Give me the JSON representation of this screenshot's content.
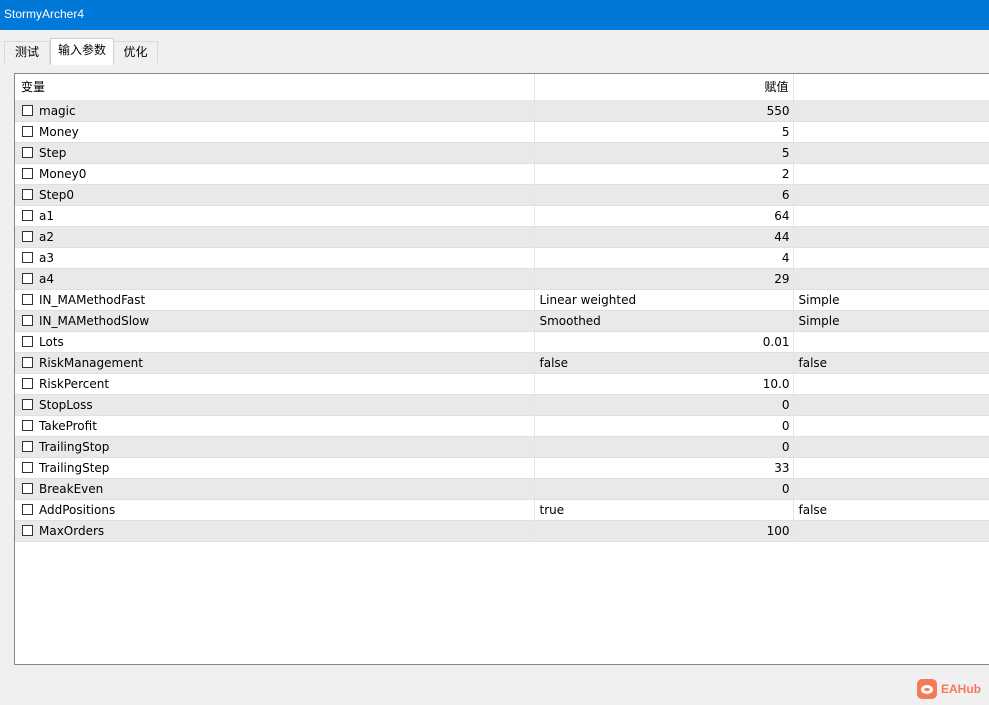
{
  "window": {
    "title": "StormyArcher4"
  },
  "tabs": [
    {
      "label": "测试"
    },
    {
      "label": "输入参数"
    },
    {
      "label": "优化"
    }
  ],
  "table": {
    "headers": {
      "variable": "变量",
      "value": "赋值",
      "extra": ""
    },
    "rows": [
      {
        "name": "magic",
        "value": "550",
        "extra": "",
        "numeric": true
      },
      {
        "name": "Money",
        "value": "5",
        "extra": "",
        "numeric": true
      },
      {
        "name": "Step",
        "value": "5",
        "extra": "",
        "numeric": true
      },
      {
        "name": "Money0",
        "value": "2",
        "extra": "",
        "numeric": true
      },
      {
        "name": "Step0",
        "value": "6",
        "extra": "",
        "numeric": true
      },
      {
        "name": "a1",
        "value": "64",
        "extra": "",
        "numeric": true
      },
      {
        "name": "a2",
        "value": "44",
        "extra": "",
        "numeric": true
      },
      {
        "name": "a3",
        "value": "4",
        "extra": "",
        "numeric": true
      },
      {
        "name": "a4",
        "value": "29",
        "extra": "",
        "numeric": true
      },
      {
        "name": "IN_MAMethodFast",
        "value": "Linear weighted",
        "extra": "Simple",
        "numeric": false
      },
      {
        "name": "IN_MAMethodSlow",
        "value": "Smoothed",
        "extra": "Simple",
        "numeric": false
      },
      {
        "name": "Lots",
        "value": "0.01",
        "extra": "",
        "numeric": true
      },
      {
        "name": "RiskManagement",
        "value": "false",
        "extra": "false",
        "numeric": false
      },
      {
        "name": "RiskPercent",
        "value": "10.0",
        "extra": "",
        "numeric": true
      },
      {
        "name": "StopLoss",
        "value": "0",
        "extra": "",
        "numeric": true
      },
      {
        "name": "TakeProfit",
        "value": "0",
        "extra": "",
        "numeric": true
      },
      {
        "name": "TrailingStop",
        "value": "0",
        "extra": "",
        "numeric": true
      },
      {
        "name": "TrailingStep",
        "value": "33",
        "extra": "",
        "numeric": true
      },
      {
        "name": "BreakEven",
        "value": "0",
        "extra": "",
        "numeric": true
      },
      {
        "name": "AddPositions",
        "value": "true",
        "extra": "false",
        "numeric": false
      },
      {
        "name": "MaxOrders",
        "value": "100",
        "extra": "",
        "numeric": true
      }
    ]
  },
  "watermark": {
    "text": "EAHub"
  }
}
